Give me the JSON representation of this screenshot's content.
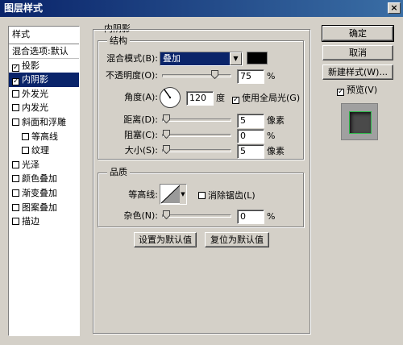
{
  "window": {
    "title": "图层样式",
    "close_glyph": "×"
  },
  "left_panel": {
    "header": "样式",
    "blend_item": "混合选项:默认",
    "items": [
      {
        "label": "投影",
        "checked": true,
        "sub": false
      },
      {
        "label": "内阴影",
        "checked": true,
        "sub": false,
        "selected": true
      },
      {
        "label": "外发光",
        "checked": false,
        "sub": false
      },
      {
        "label": "内发光",
        "checked": false,
        "sub": false
      },
      {
        "label": "斜面和浮雕",
        "checked": false,
        "sub": false
      },
      {
        "label": "等高线",
        "checked": false,
        "sub": true
      },
      {
        "label": "纹理",
        "checked": false,
        "sub": true
      },
      {
        "label": "光泽",
        "checked": false,
        "sub": false
      },
      {
        "label": "颜色叠加",
        "checked": false,
        "sub": false
      },
      {
        "label": "渐变叠加",
        "checked": false,
        "sub": false
      },
      {
        "label": "图案叠加",
        "checked": false,
        "sub": false
      },
      {
        "label": "描边",
        "checked": false,
        "sub": false
      }
    ]
  },
  "inner_shadow": {
    "section_title": "内阴影",
    "structure": {
      "title": "结构",
      "blend_mode_label": "混合模式(B):",
      "blend_mode_value": "叠加",
      "shadow_color": "#000000",
      "opacity_label": "不透明度(O):",
      "opacity_value": "75",
      "opacity_unit": "%",
      "angle_label": "角度(A):",
      "angle_value": "120",
      "angle_unit": "度",
      "global_light_label": "使用全局光(G)",
      "global_light_checked": true,
      "distance_label": "距离(D):",
      "distance_value": "5",
      "distance_unit": "像素",
      "choke_label": "阻塞(C):",
      "choke_value": "0",
      "choke_unit": "%",
      "size_label": "大小(S):",
      "size_value": "5",
      "size_unit": "像素"
    },
    "quality": {
      "title": "品质",
      "contour_label": "等高线:",
      "antialias_label": "消除锯齿(L)",
      "antialias_checked": false,
      "noise_label": "杂色(N):",
      "noise_value": "0",
      "noise_unit": "%"
    },
    "buttons": {
      "set_default": "设置为默认值",
      "reset_default": "复位为默认值"
    }
  },
  "right": {
    "ok": "确定",
    "cancel": "取消",
    "new_style": "新建样式(W)...",
    "preview_label": "预览(V)",
    "preview_checked": true
  },
  "colors": {
    "title_bar": "#0a246a",
    "selection": "#0a246a",
    "preview_glow": "#2db84b"
  }
}
